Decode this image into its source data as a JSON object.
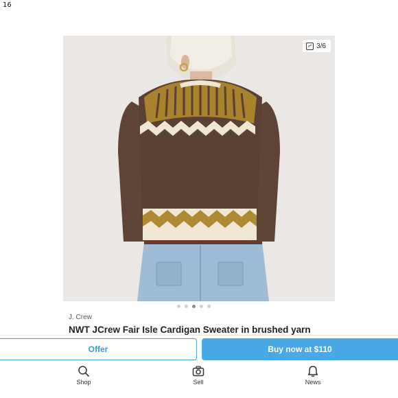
{
  "status": {
    "time": "16"
  },
  "gallery": {
    "counter": "3/6",
    "counter_icon": "photo-stack-icon",
    "dot_count": 5,
    "active_dot": 2,
    "image_alt": "Woman seen from behind wearing a brown Fair Isle cardigan with gold and cream yoke pattern and light-wash jeans"
  },
  "listing": {
    "brand": "J. Crew",
    "title": "NWT JCrew Fair Isle Cardigan Sweater in brushed yarn"
  },
  "actions": {
    "offer_label": "Offer",
    "buy_label": "Buy now at $110"
  },
  "tabs": [
    {
      "label": "Shop",
      "icon": "search-icon"
    },
    {
      "label": "Sell",
      "icon": "camera-icon"
    },
    {
      "label": "News",
      "icon": "bell-icon"
    }
  ],
  "colors": {
    "accent": "#49a8e6",
    "sweater_brown": "#5a3f33",
    "yoke_gold": "#a8822c",
    "cream": "#efe6d3"
  }
}
